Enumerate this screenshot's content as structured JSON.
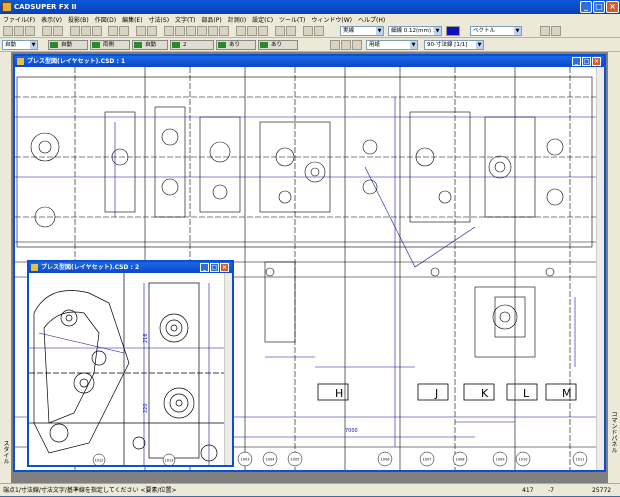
{
  "app": {
    "title": "CADSUPER FX II"
  },
  "menu": [
    "ファイル(F)",
    "表示(V)",
    "投影(B)",
    "作図(D)",
    "編集(E)",
    "寸法(S)",
    "文字(T)",
    "部品(P)",
    "計測(I)",
    "設定(C)",
    "ツール(T)",
    "ウィンドウ(W)",
    "ヘルプ(H)"
  ],
  "toolbar1": {
    "linetype": "実線",
    "linewidth": "細線 0.12(mm) 1",
    "layer": "ベクトル"
  },
  "toolbar2": {
    "mode": "自動",
    "buttons": [
      "自動",
      "両側",
      "自動",
      "2",
      "あり",
      "あり"
    ],
    "paper": "用紙",
    "dimstyle": "90-寸法線 [1/1]"
  },
  "windows": [
    {
      "title": "プレス型図(レイヤセット).CSD : 1"
    },
    {
      "title": "プレス型図(レイヤセット).CSD : 2"
    }
  ],
  "side": {
    "left": "スタイル",
    "right": "コマンドパネル"
  },
  "drawing": {
    "letters": [
      "H",
      "J",
      "K",
      "L",
      "M"
    ],
    "dims": [
      "7000",
      "216",
      "220"
    ],
    "bubbles": [
      "1002",
      "1003",
      "1004",
      "1005",
      "1006",
      "1007",
      "1008",
      "1009",
      "1010",
      "1011",
      "1012",
      "1013"
    ]
  },
  "status": {
    "text": "端点1/寸法線/寸法文字/基準線を指定してください <要素/位置>",
    "x": "417",
    "y": "-7",
    "z": "25772"
  }
}
